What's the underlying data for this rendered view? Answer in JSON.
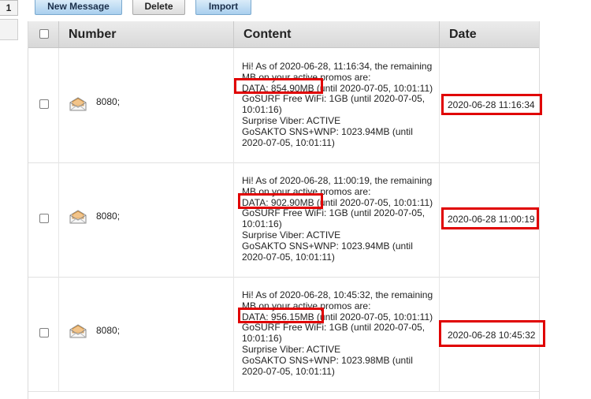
{
  "pager": {
    "page": "1"
  },
  "toolbar": {
    "new_message": "New Message",
    "delete": "Delete",
    "import": "Import"
  },
  "table": {
    "headers": {
      "number": "Number",
      "content": "Content",
      "date": "Date"
    },
    "rows": [
      {
        "number": "8080;",
        "content": [
          "Hi! As of 2020-06-28, 11:16:34, the remaining",
          "MB on your active promos are:",
          "DATA: 854.90MB (until 2020-07-05, 10:01:11)",
          "GoSURF Free WiFi: 1GB (until 2020-07-05,",
          "10:01:16)",
          "Surprise Viber: ACTIVE",
          "GoSAKTO SNS+WNP: 1023.94MB (until",
          "2020-07-05, 10:01:11)"
        ],
        "date": "2020-06-28 11:16:34"
      },
      {
        "number": "8080;",
        "content": [
          "Hi! As of 2020-06-28, 11:00:19, the remaining",
          "MB on your active promos are:",
          "DATA: 902.90MB (until 2020-07-05, 10:01:11)",
          "GoSURF Free WiFi: 1GB (until 2020-07-05,",
          "10:01:16)",
          "Surprise Viber: ACTIVE",
          "GoSAKTO SNS+WNP: 1023.94MB (until",
          "2020-07-05, 10:01:11)"
        ],
        "date": "2020-06-28 11:00:19"
      },
      {
        "number": "8080;",
        "content": [
          "Hi! As of 2020-06-28, 10:45:32, the remaining",
          "MB on your active promos are:",
          "DATA: 956.15MB (until 2020-07-05, 10:01:11)",
          "GoSURF Free WiFi: 1GB (until 2020-07-05,",
          "10:01:16)",
          "Surprise Viber: ACTIVE",
          "GoSAKTO SNS+WNP: 1023.98MB (until",
          "2020-07-05, 10:01:11)"
        ],
        "date": "2020-06-28 10:45:32"
      }
    ]
  },
  "colors": {
    "highlight": "#e00000",
    "button_blue": "#a9cfee",
    "header_bg": "#dcdcdc"
  },
  "icons": {
    "message": "envelope-open-icon"
  }
}
